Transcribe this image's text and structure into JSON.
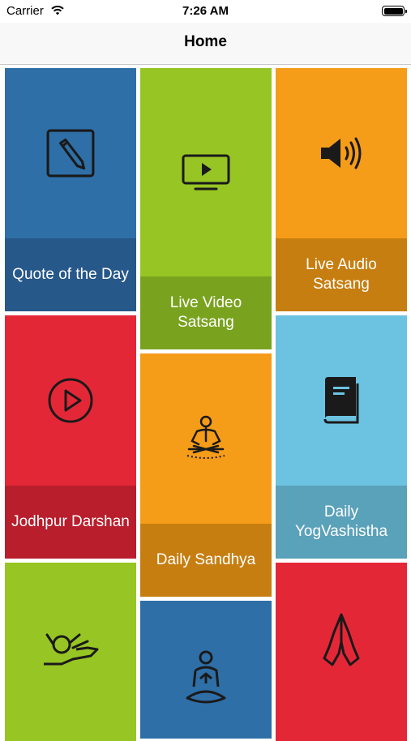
{
  "status_bar": {
    "carrier": "Carrier",
    "time": "7:26 AM"
  },
  "nav": {
    "title": "Home"
  },
  "tiles": [
    {
      "label": "Quote of the Day",
      "icon": "pencil-square-icon",
      "color": "#2f6fa7",
      "label_color": "#27588a"
    },
    {
      "label": "Live Video Satsang",
      "icon": "tv-play-icon",
      "color": "#97c524",
      "label_color": "#79a31f"
    },
    {
      "label": "Live Audio Satsang",
      "icon": "speaker-icon",
      "color": "#f59c18",
      "label_color": "#c77e11"
    },
    {
      "label": "Jodhpur Darshan",
      "icon": "play-circle-icon",
      "color": "#e42737",
      "label_color": "#b91e2c"
    },
    {
      "label": "Daily Sandhya",
      "icon": "meditation-figure-icon",
      "color": "#f59c18",
      "label_color": "#c77e11"
    },
    {
      "label": "Daily YogVashistha",
      "icon": "book-icon",
      "color": "#6cc3e1",
      "label_color": "#5aa1ba"
    },
    {
      "label": "",
      "icon": "mudra-hand-icon",
      "color": "#97c524",
      "label_color": "#79a31f"
    },
    {
      "label": "",
      "icon": "yoga-pose-icon",
      "color": "#2f6fa7",
      "label_color": "#27588a"
    },
    {
      "label": "",
      "icon": "praying-hands-icon",
      "color": "#e42737",
      "label_color": "#b91e2c"
    }
  ]
}
